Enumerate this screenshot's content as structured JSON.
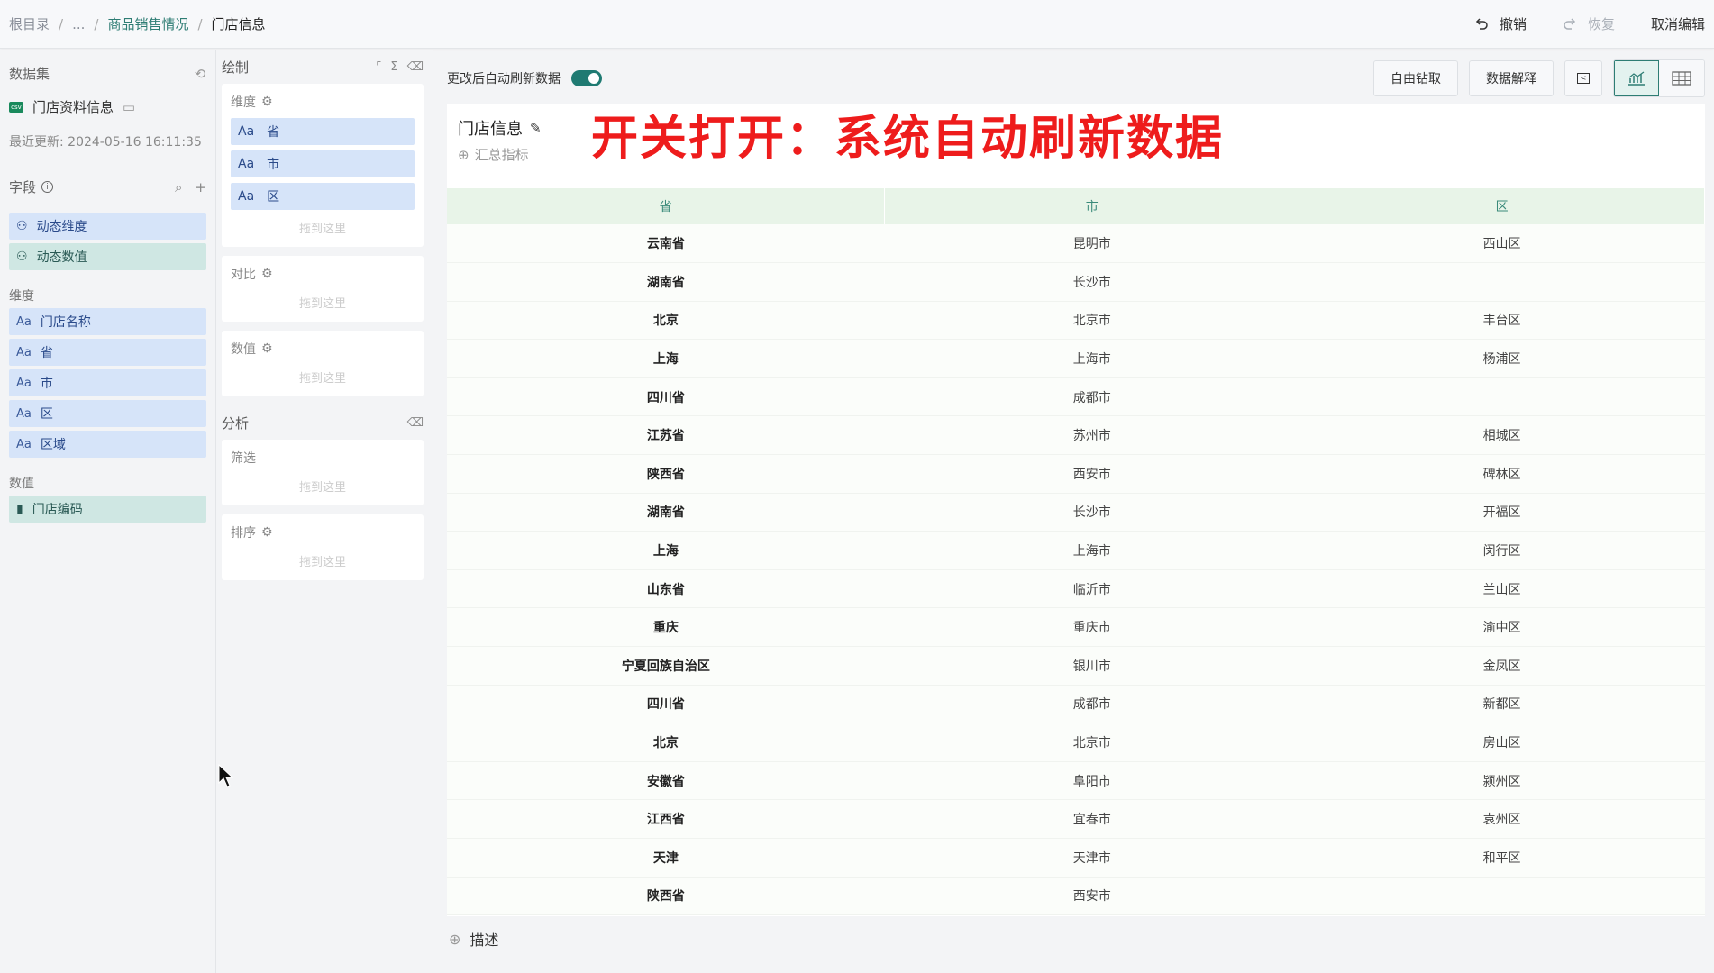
{
  "breadcrumb": {
    "root": "根目录",
    "ellipsis": "...",
    "parent": "商品销售情况",
    "current": "门店信息"
  },
  "header": {
    "undo": "撤销",
    "redo": "恢复",
    "cancel_edit": "取消编辑"
  },
  "left": {
    "dataset_title": "数据集",
    "dataset_name": "门店资料信息",
    "updated": "最近更新: 2024-05-16 16:11:35",
    "fields_title": "字段",
    "dynamic": [
      {
        "label": "动态维度"
      },
      {
        "label": "动态数值"
      }
    ],
    "dim_title": "维度",
    "dims": [
      {
        "label": "门店名称"
      },
      {
        "label": "省"
      },
      {
        "label": "市"
      },
      {
        "label": "区"
      },
      {
        "label": "区域"
      }
    ],
    "measure_title": "数值",
    "measures": [
      {
        "label": "门店编码"
      }
    ],
    "aa": "Aa"
  },
  "config": {
    "draw_title": "绘制",
    "dim_label": "维度",
    "chips": [
      {
        "label": "省"
      },
      {
        "label": "市"
      },
      {
        "label": "区"
      }
    ],
    "drop_hint": "拖到这里",
    "compare_label": "对比",
    "value_label": "数值",
    "analysis_title": "分析",
    "filter_label": "筛选",
    "sort_label": "排序"
  },
  "toolbar": {
    "auto_refresh": "更改后自动刷新数据",
    "drill": "自由钻取",
    "explain": "数据解释"
  },
  "card": {
    "title": "门店信息",
    "summary": "汇总指标",
    "annotation": "开关打开：系统自动刷新数据",
    "columns": [
      "省",
      "市",
      "区"
    ],
    "rows": [
      [
        "云南省",
        "昆明市",
        "西山区"
      ],
      [
        "湖南省",
        "长沙市",
        ""
      ],
      [
        "北京",
        "北京市",
        "丰台区"
      ],
      [
        "上海",
        "上海市",
        "杨浦区"
      ],
      [
        "四川省",
        "成都市",
        ""
      ],
      [
        "江苏省",
        "苏州市",
        "相城区"
      ],
      [
        "陕西省",
        "西安市",
        "碑林区"
      ],
      [
        "湖南省",
        "长沙市",
        "开福区"
      ],
      [
        "上海",
        "上海市",
        "闵行区"
      ],
      [
        "山东省",
        "临沂市",
        "兰山区"
      ],
      [
        "重庆",
        "重庆市",
        "渝中区"
      ],
      [
        "宁夏回族自治区",
        "银川市",
        "金凤区"
      ],
      [
        "四川省",
        "成都市",
        "新都区"
      ],
      [
        "北京",
        "北京市",
        "房山区"
      ],
      [
        "安徽省",
        "阜阳市",
        "颍州区"
      ],
      [
        "江西省",
        "宜春市",
        "袁州区"
      ],
      [
        "天津",
        "天津市",
        "和平区"
      ],
      [
        "陕西省",
        "西安市",
        ""
      ]
    ]
  },
  "describe": "描述"
}
